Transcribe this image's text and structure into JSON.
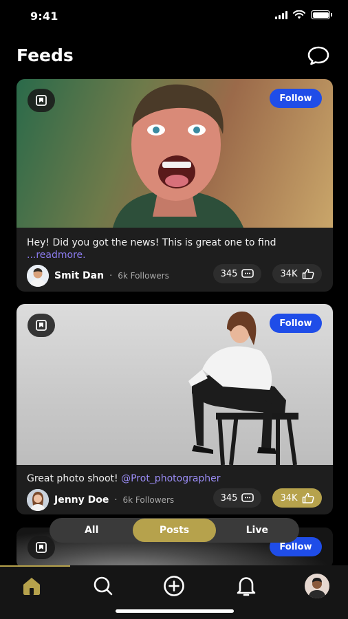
{
  "status": {
    "time": "9:41"
  },
  "header": {
    "title": "Feeds",
    "chat_icon": "chat-bubble-icon"
  },
  "posts": [
    {
      "caption": "Hey! Did you got the news! This is great one to find",
      "readmore": "...readmore.",
      "author": "Smit Dan",
      "separator": "·",
      "followers": "6k Followers",
      "follow_label": "Follow",
      "comments": "345",
      "likes": "34K",
      "likes_active": false
    },
    {
      "caption": "Great photo shoot! ",
      "mention": "@Prot_photographer",
      "author": "Jenny Doe",
      "separator": "·",
      "followers": "6k Followers",
      "follow_label": "Follow",
      "comments": "345",
      "likes": "34K",
      "likes_active": true
    },
    {
      "follow_label": "Follow"
    }
  ],
  "filter": {
    "options": [
      "All",
      "Posts",
      "Live"
    ],
    "selected": "Posts"
  },
  "nav": {
    "items": [
      "home",
      "search",
      "create",
      "notifications",
      "profile"
    ],
    "active": "home"
  },
  "colors": {
    "accent": "#b6a24c",
    "follow": "#1f4de8",
    "background": "#000000",
    "card": "#1e1e1e"
  }
}
